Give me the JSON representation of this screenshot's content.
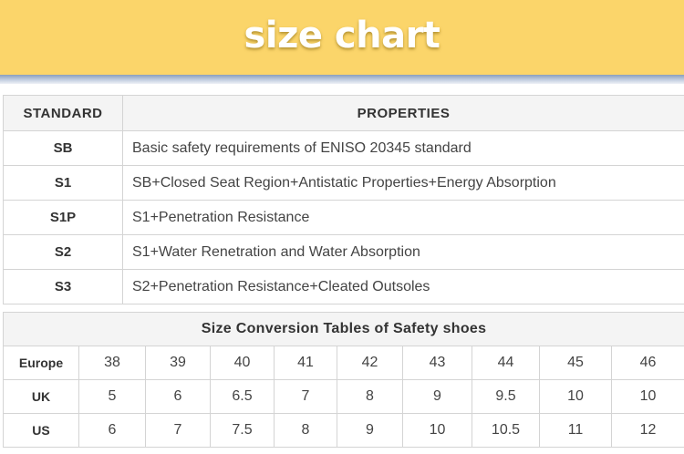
{
  "banner": {
    "title": "size chart"
  },
  "properties_table": {
    "headers": [
      "STANDARD",
      "PROPERTIES"
    ],
    "rows": [
      {
        "standard": "SB",
        "properties": "Basic safety requirements of ENISO 20345 standard"
      },
      {
        "standard": "S1",
        "properties": "SB+Closed Seat Region+Antistatic Properties+Energy Absorption"
      },
      {
        "standard": "S1P",
        "properties": "S1+Penetration Resistance"
      },
      {
        "standard": "S2",
        "properties": "S1+Water Renetration and Water Absorption"
      },
      {
        "standard": "S3",
        "properties": "S2+Penetration Resistance+Cleated Outsoles"
      }
    ]
  },
  "size_table": {
    "caption": "Size Conversion Tables of Safety shoes",
    "rows": [
      {
        "label": "Europe",
        "values": [
          "38",
          "39",
          "40",
          "41",
          "42",
          "43",
          "44",
          "45",
          "46"
        ]
      },
      {
        "label": "UK",
        "values": [
          "5",
          "6",
          "6.5",
          "7",
          "8",
          "9",
          "9.5",
          "10",
          "10"
        ]
      },
      {
        "label": "US",
        "values": [
          "6",
          "7",
          "7.5",
          "8",
          "9",
          "10",
          "10.5",
          "11",
          "12"
        ]
      }
    ]
  }
}
